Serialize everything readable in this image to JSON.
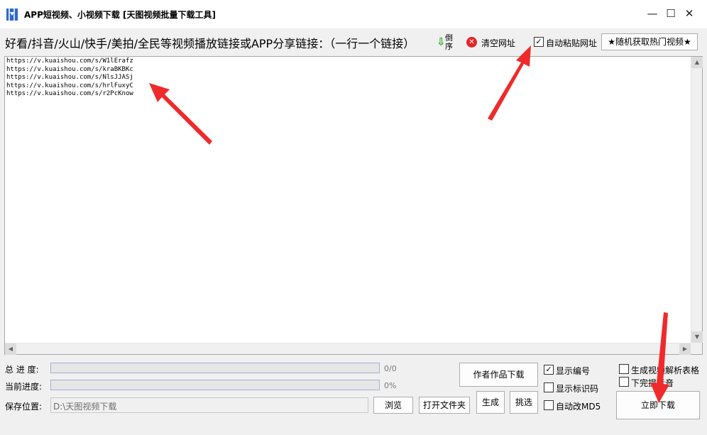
{
  "window": {
    "title": "APP短视频、小视频下载 [天图视频批量下载工具]",
    "minimize_glyph": "—",
    "maximize_glyph": "☐",
    "close_glyph": "✕"
  },
  "toolbar": {
    "prompt": "好看/抖音/火山/快手/美拍/全民等视频播放链接或APP分享链接：（一行一个链接）",
    "reverse_arrow": "⇩",
    "reverse_label": "倒序",
    "clear_label": "清空网址",
    "clear_glyph": "✕",
    "auto_paste_label": "自动粘贴网址",
    "auto_paste_checked": "✓",
    "hot_videos_label": "★随机获取热门视频★"
  },
  "links": [
    "https://v.kuaishou.com/s/W1lErafz",
    "https://v.kuaishou.com/s/kraBKBKc",
    "https://v.kuaishou.com/s/NlsJJASj",
    "https://v.kuaishou.com/s/hrlFuxyC",
    "https://v.kuaishou.com/s/r2PcKnow"
  ],
  "scroll": {
    "up": "▲",
    "down": "▼",
    "left": "◀",
    "right": "▶"
  },
  "progress": {
    "total_label": "总 进 度:",
    "total_text": "0/0",
    "total_fraction": 0,
    "current_label": "当前进度:",
    "current_text": "0%",
    "current_fraction": 0
  },
  "save": {
    "label": "保存位置:",
    "path": "D:\\天图视频下载",
    "browse_label": "浏览",
    "open_folder_label": "打开文件夹"
  },
  "actions": {
    "author_download_label": "作者作品下载",
    "generate_label": "生成",
    "pick_label": "挑选",
    "download_now_label": "立即下载"
  },
  "options": {
    "show_number_label": "显示编号",
    "show_number_checked": "✓",
    "show_id_label": "显示标识码",
    "auto_md5_label": "自动改MD5",
    "gen_table_label": "生成视频解析表格",
    "notify_sound_label": "下完提示音"
  },
  "colors": {
    "arrow": "#f02a2a",
    "progress_border": "#9fb3d8",
    "clear_icon": "#e2262a",
    "reverse_icon": "#2aa62a"
  }
}
